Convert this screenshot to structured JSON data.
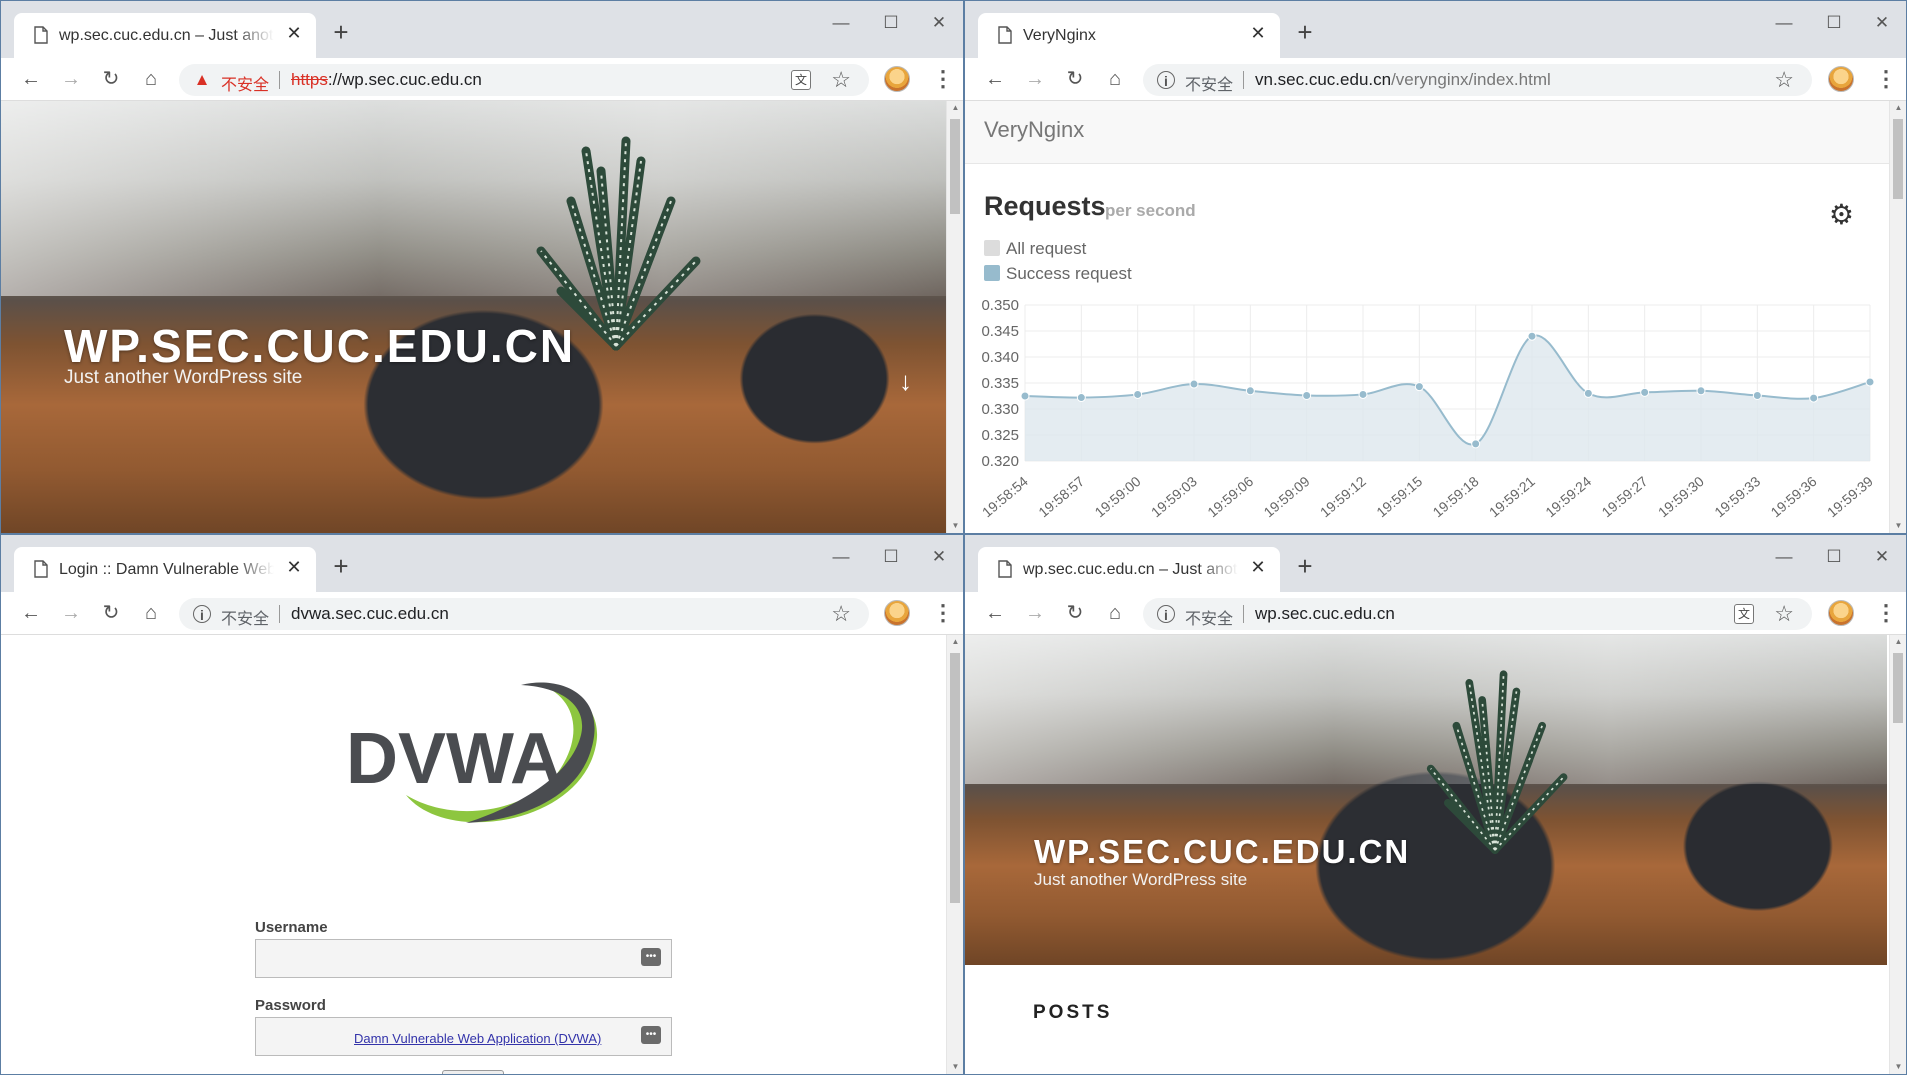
{
  "windows": {
    "top_left": {
      "tab_title": "wp.sec.cuc.edu.cn – Just another WordPress site",
      "security_label": "不安全",
      "url_scheme": "https",
      "url_rest": "://wp.sec.cuc.edu.cn",
      "site_title": "WP.SEC.CUC.EDU.CN",
      "site_description": "Just another WordPress site"
    },
    "top_right": {
      "tab_title": "VeryNginx",
      "security_label": "不安全",
      "url_host": "vn.sec.cuc.edu.cn",
      "url_path": "/verynginx/index.html",
      "brand": "VeryNginx",
      "heading": "Requests",
      "heading_sub": "per second",
      "legend": [
        "All request",
        "Success request"
      ]
    },
    "bottom_left": {
      "tab_title": "Login :: Damn Vulnerable Web Application (DVWA)",
      "security_label": "不安全",
      "url": "dvwa.sec.cuc.edu.cn",
      "logo_text": "DVWA",
      "username_label": "Username",
      "password_label": "Password",
      "password_field_suggestion": "Damn Vulnerable Web Application (DVWA)"
    },
    "bottom_right": {
      "tab_title": "wp.sec.cuc.edu.cn – Just another WordPress site",
      "security_label": "不安全",
      "url": "wp.sec.cuc.edu.cn",
      "site_title": "WP.SEC.CUC.EDU.CN",
      "site_description": "Just another WordPress site",
      "posts_heading": "POSTS"
    }
  },
  "chart_data": {
    "type": "area",
    "x": [
      "19:58:54",
      "19:58:57",
      "19:59:00",
      "19:59:03",
      "19:59:06",
      "19:59:09",
      "19:59:12",
      "19:59:15",
      "19:59:18",
      "19:59:21",
      "19:59:24",
      "19:59:27",
      "19:59:30",
      "19:59:33",
      "19:59:36",
      "19:59:39"
    ],
    "series": [
      {
        "name": "Success request",
        "values": [
          0.3325,
          0.3322,
          0.3328,
          0.3348,
          0.3335,
          0.3326,
          0.3328,
          0.3343,
          0.3233,
          0.344,
          0.333,
          0.3332,
          0.3335,
          0.3326,
          0.3321,
          0.3352
        ]
      }
    ],
    "ylim": [
      0.32,
      0.35
    ],
    "yticks": [
      "0.350",
      "0.345",
      "0.340",
      "0.335",
      "0.330",
      "0.325",
      "0.320"
    ],
    "color": "#97bbcd",
    "grid": true
  },
  "colors": {
    "accent_red": "#d93025",
    "chart_line": "#97bbcd",
    "chart_fill": "#dde7ee"
  }
}
